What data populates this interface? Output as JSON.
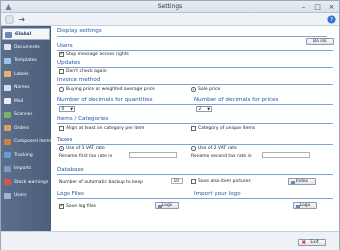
{
  "window": {
    "title": "Settings"
  },
  "sidebar": {
    "items": [
      {
        "label": "Global",
        "icon": "globe-icon",
        "color": "#6a86b5"
      },
      {
        "label": "Documents",
        "icon": "documents-icon",
        "color": "#e0e6ee"
      },
      {
        "label": "Templates",
        "icon": "templates-icon",
        "color": "#9fc3e8"
      },
      {
        "label": "Labels",
        "icon": "labels-icon",
        "color": "#e7b46a"
      },
      {
        "label": "Names",
        "icon": "names-icon",
        "color": "#cfe0f2"
      },
      {
        "label": "Mail",
        "icon": "mail-icon",
        "color": "#e9edf2"
      },
      {
        "label": "Scanner",
        "icon": "scanner-icon",
        "color": "#7fb06a"
      },
      {
        "label": "Orders",
        "icon": "orders-icon",
        "color": "#d9a05b"
      },
      {
        "label": "Composed items",
        "icon": "composed-items-icon",
        "color": "#c9823f"
      },
      {
        "label": "Tracking",
        "icon": "tracking-icon",
        "color": "#5fa0d8"
      },
      {
        "label": "Imports",
        "icon": "imports-icon",
        "color": "#7d9ac7"
      },
      {
        "label": "Stock warnings",
        "icon": "stock-warnings-icon",
        "color": "#d9534f"
      },
      {
        "label": "Users",
        "icon": "users-icon",
        "color": "#9ab5d6"
      }
    ]
  },
  "display": {
    "title": "Display settings",
    "ok_label": "Ba ink"
  },
  "users": {
    "title": "Users",
    "stop_message": "Stop message access rights"
  },
  "updates": {
    "title": "Updates",
    "dont_check": "Don't check again"
  },
  "invoice": {
    "title": "Invoice method",
    "buying_price": "Buying price or weighted average price",
    "sale_price": "Sale price",
    "selected": "sale_price"
  },
  "decimals": {
    "quantities_label": "Number of decimals for quantities",
    "quantities_value": "0",
    "prices_label": "Number of decimals for prices",
    "prices_value": "2"
  },
  "items": {
    "title": "Items / Categories",
    "align_label": "Align at least on category per item",
    "unique_label": "Category of unique items"
  },
  "taxes": {
    "title": "Taxes",
    "use_1": "Use of 1 VAT rate",
    "use_2": "Use of 2 VAT rate",
    "rename_first": "Rename first tax rate in",
    "rename_second": "Rename second tax rate in",
    "selected": "use_1"
  },
  "database": {
    "title": "Database",
    "backup_label": "Number of automatic backup to keep",
    "backup_value": "10",
    "save_pictures": "Save also item pictures",
    "index_label": "Index"
  },
  "logs": {
    "title": "Logs Files",
    "save_label": "Save log files",
    "logs_button": "Logs"
  },
  "import_logo": {
    "title": "Import your logo",
    "logo_button": "Logo"
  },
  "footer": {
    "exit_label": "Exit"
  }
}
